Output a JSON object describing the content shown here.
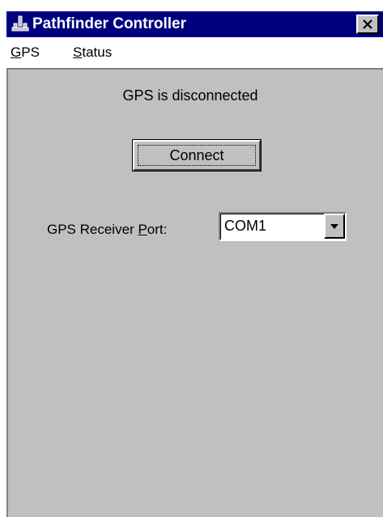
{
  "window": {
    "title": "Pathfinder Controller",
    "title_bar_color": "#00007f",
    "face_color": "#c0c0c0",
    "icon": "joystick-icon",
    "close_icon": "close-icon"
  },
  "menu": {
    "items": [
      {
        "first": "G",
        "rest": "PS"
      },
      {
        "first": "S",
        "rest": "tatus"
      }
    ]
  },
  "main": {
    "status_text": "GPS is disconnected",
    "connect_label": "Connect",
    "port_label_before": "GPS Receiver ",
    "port_label_mnemonic": "P",
    "port_label_after": "ort:",
    "port_value": "COM1",
    "dropdown_icon": "chevron-down-icon"
  }
}
